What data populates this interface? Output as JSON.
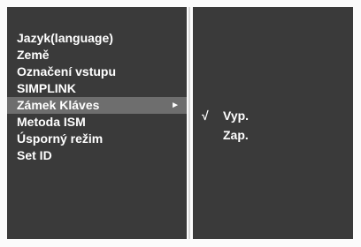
{
  "menu": {
    "items": [
      {
        "label": "Jazyk(language)"
      },
      {
        "label": "Země"
      },
      {
        "label": "Označení vstupu"
      },
      {
        "label": "SIMPLINK"
      },
      {
        "label": "Zámek Kláves",
        "selected": true
      },
      {
        "label": "Metoda ISM"
      },
      {
        "label": "Úsporný režim"
      },
      {
        "label": "Set ID"
      }
    ],
    "submenu_arrow": "►"
  },
  "submenu": {
    "options": [
      {
        "label": "Vyp.",
        "checked": true
      },
      {
        "label": "Zap.",
        "checked": false
      }
    ],
    "check_mark": "√"
  },
  "colors": {
    "panel": "#3a3a3a",
    "highlight": "#6e6e6e",
    "text": "#ffffff"
  }
}
